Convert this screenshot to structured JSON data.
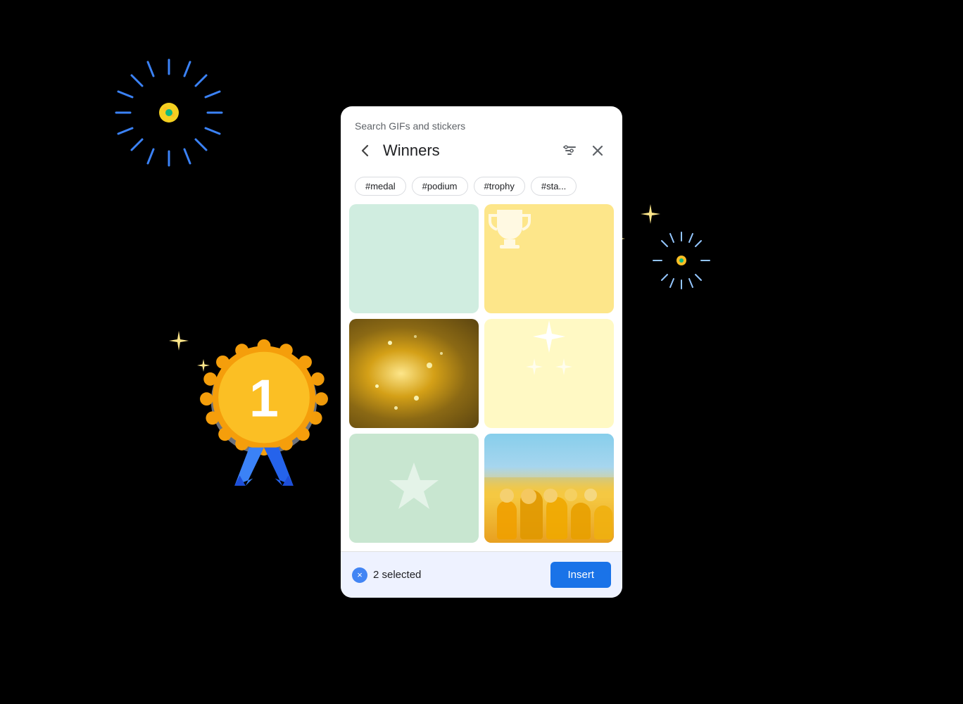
{
  "search": {
    "header_label": "Search GIFs and stickers",
    "query": "Winners",
    "back_label": "←",
    "close_label": "×"
  },
  "tags": [
    {
      "id": "medal",
      "label": "#medal"
    },
    {
      "id": "podium",
      "label": "#podium"
    },
    {
      "id": "trophy",
      "label": "#trophy"
    },
    {
      "id": "star",
      "label": "#sta..."
    }
  ],
  "grid": {
    "cells": [
      {
        "id": "cell-1",
        "type": "mint",
        "alt": "mint background"
      },
      {
        "id": "cell-2",
        "type": "yellow-trophy",
        "alt": "trophy GIF"
      },
      {
        "id": "cell-3",
        "type": "gold-glitter",
        "alt": "gold glitter"
      },
      {
        "id": "cell-4",
        "type": "cream-sparkle",
        "alt": "sparkles GIF"
      },
      {
        "id": "cell-5",
        "type": "mint-star",
        "alt": "star GIF"
      },
      {
        "id": "cell-6",
        "type": "people",
        "alt": "winners team photo"
      }
    ]
  },
  "bottom_bar": {
    "selected_count": "2 selected",
    "insert_label": "Insert",
    "clear_label": "×"
  },
  "decor": {
    "blue_burst_color": "#3b82f6",
    "yellow_dot_color": "#f5d020",
    "light_burst_color": "#93c5fd"
  }
}
